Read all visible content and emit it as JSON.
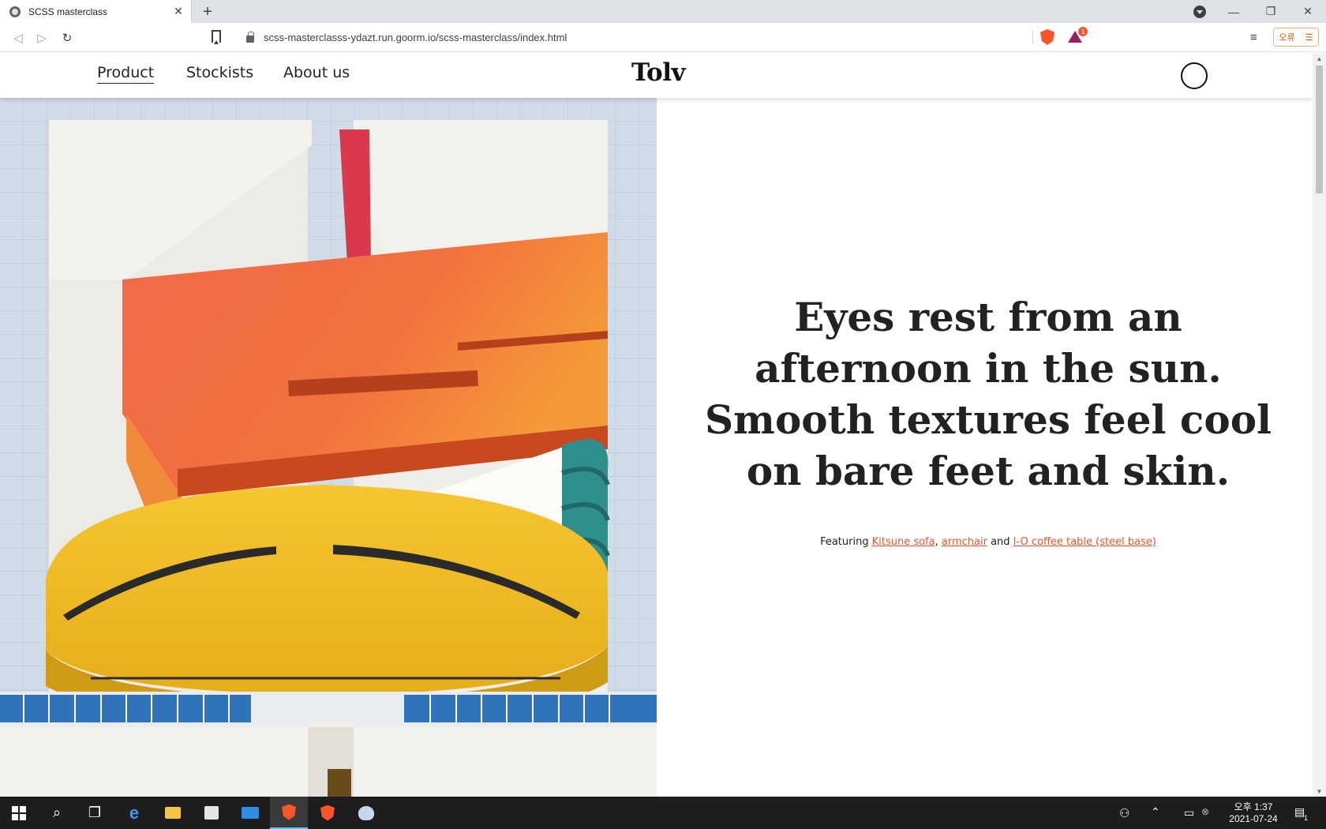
{
  "browser": {
    "tab_title": "SCSS masterclass",
    "tab_close": "✕",
    "new_tab": "+",
    "url": "scss-masterclasss-ydazt.run.goorm.io/scss-masterclass/index.html",
    "rewards_badge": "1",
    "menu_label": "오류",
    "menu_icon": "☰",
    "window_controls": {
      "minimize": "—",
      "restore": "❐",
      "close": "✕"
    },
    "nav": {
      "back": "◁",
      "forward": "▷",
      "reload": "↻"
    },
    "playlist_icon": "≡"
  },
  "site": {
    "nav": [
      {
        "label": "Product"
      },
      {
        "label": "Stockists"
      },
      {
        "label": "About us"
      }
    ],
    "logo": "Tolv",
    "headline": "Eyes rest from an afternoon in the sun. Smooth textures feel cool on bare feet and skin.",
    "featuring": {
      "prefix": "Featuring ",
      "link1": "Kitsune sofa",
      "sep1": ", ",
      "link2": "armchair",
      "sep2": " and ",
      "link3": "I-O coffee table (steel base)"
    },
    "colors": {
      "link": "#e4572e",
      "text": "#222222"
    }
  },
  "taskbar": {
    "time": "오후 1:37",
    "date": "2021-07-24",
    "notifications": "1",
    "apps": [
      "start-icon",
      "search-icon",
      "task-view-icon",
      "edge-icon",
      "file-explorer-icon",
      "store-icon",
      "mail-icon",
      "brave-icon",
      "brave-beta-icon",
      "paint-icon"
    ]
  }
}
